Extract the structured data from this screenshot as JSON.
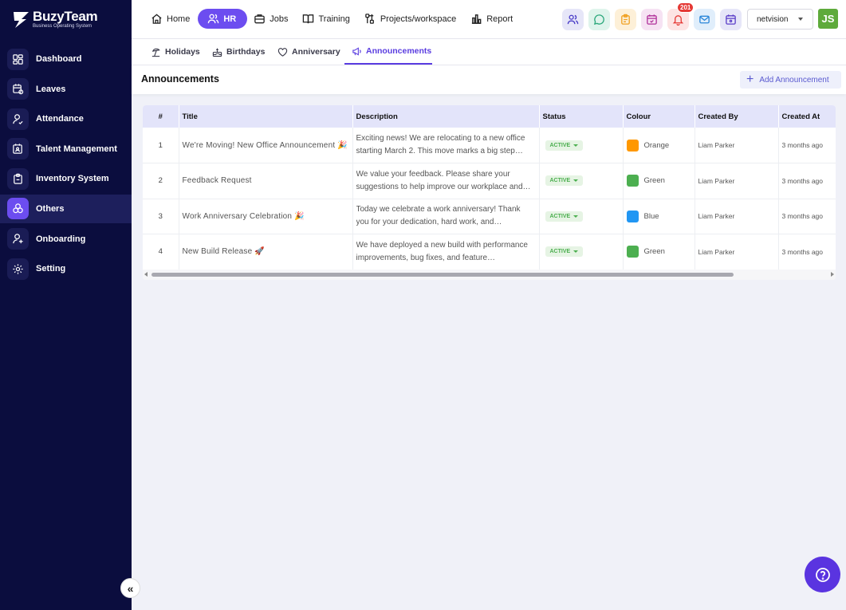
{
  "brand": {
    "name": "BuzyTeam",
    "tagline": "Business Operating System"
  },
  "sidebar": {
    "items": [
      {
        "label": "Dashboard",
        "icon": "dashboard-grid-icon"
      },
      {
        "label": "Leaves",
        "icon": "calendar-leave-icon"
      },
      {
        "label": "Attendance",
        "icon": "user-check-icon"
      },
      {
        "label": "Talent Management",
        "icon": "calendar-user-icon"
      },
      {
        "label": "Inventory System",
        "icon": "clipboard-icon"
      },
      {
        "label": "Others",
        "icon": "others-circles-icon",
        "active": true
      },
      {
        "label": "Onboarding",
        "icon": "user-plus-icon"
      },
      {
        "label": "Setting",
        "icon": "gear-icon"
      }
    ],
    "collapse_label": "«"
  },
  "topnav": {
    "items": [
      {
        "label": "Home",
        "icon": "home-icon"
      },
      {
        "label": "HR",
        "icon": "users-icon",
        "active": true
      },
      {
        "label": "Jobs",
        "icon": "briefcase-icon"
      },
      {
        "label": "Training",
        "icon": "book-icon"
      },
      {
        "label": "Projects/workspace",
        "icon": "kanban-icon"
      },
      {
        "label": "Report",
        "icon": "bar-chart-icon"
      }
    ]
  },
  "top_icons": [
    {
      "name": "team-icon",
      "bg": "#e6e6f8",
      "color": "#4a3dc8"
    },
    {
      "name": "chat-icon",
      "bg": "#dff4ec",
      "color": "#2aa77a"
    },
    {
      "name": "clipboard-icon",
      "bg": "#fdf0d8",
      "color": "#f0a020"
    },
    {
      "name": "calendar-icon",
      "bg": "#f6e2f3",
      "color": "#b0309a"
    },
    {
      "name": "bell-icon",
      "bg": "#fde4e4",
      "color": "#e53935",
      "badge": "201"
    },
    {
      "name": "mail-icon",
      "bg": "#e0eefb",
      "color": "#2a86d8"
    },
    {
      "name": "calendar-icon",
      "bg": "#e6e6f8",
      "color": "#5a3dc8"
    }
  ],
  "org_select": {
    "value": "netvision"
  },
  "avatar": {
    "initials": "JS"
  },
  "subtabs": [
    {
      "label": "Holidays",
      "icon": "beach-icon"
    },
    {
      "label": "Birthdays",
      "icon": "cake-icon"
    },
    {
      "label": "Anniversary",
      "icon": "heart-icon"
    },
    {
      "label": "Announcements",
      "icon": "megaphone-icon",
      "active": true
    }
  ],
  "page": {
    "title": "Announcements",
    "add_button": "Add Announcement"
  },
  "table": {
    "columns": [
      "#",
      "Title",
      "Description",
      "Status",
      "Colour",
      "Created By",
      "Created At"
    ],
    "rows": [
      {
        "num": "1",
        "title": "We're Moving! New Office Announcement 🎉",
        "description": "Exciting news! We are relocating to a new office starting March 2. This move marks a big step…",
        "status": "ACTIVE",
        "colour": "Orange",
        "colour_hex": "#ff9800",
        "created_by": "Liam Parker",
        "created_at": "3 months ago"
      },
      {
        "num": "2",
        "title": "Feedback Request",
        "description": "We value your feedback. Please share your suggestions to help improve our workplace and…",
        "status": "ACTIVE",
        "colour": "Green",
        "colour_hex": "#4caf50",
        "created_by": "Liam Parker",
        "created_at": "3 months ago"
      },
      {
        "num": "3",
        "title": "Work Anniversary Celebration 🎉",
        "description": "Today we celebrate a work anniversary! Thank you for your dedication, hard work, and contribution …",
        "status": "ACTIVE",
        "colour": "Blue",
        "colour_hex": "#2196f3",
        "created_by": "Liam Parker",
        "created_at": "3 months ago"
      },
      {
        "num": "4",
        "title": "New Build Release 🚀",
        "description": "We have deployed a new build with performance improvements, bug fixes, and feature…",
        "status": "ACTIVE",
        "colour": "Green",
        "colour_hex": "#4caf50",
        "created_by": "Liam Parker",
        "created_at": "3 months ago"
      }
    ]
  },
  "colors": {
    "sidebar_bg": "#0b0d3e",
    "accent": "#6c4df0",
    "header_row_bg": "#e3e4fa"
  }
}
